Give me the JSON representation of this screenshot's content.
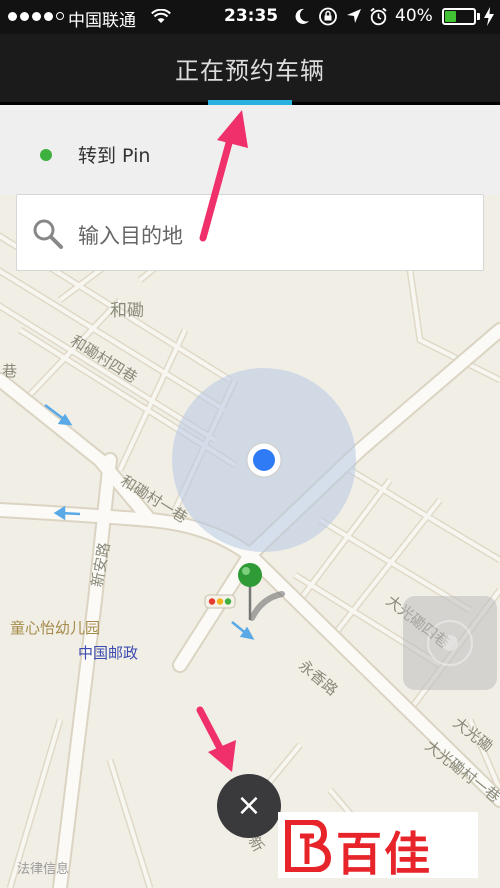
{
  "status_bar": {
    "carrier": "中国联通",
    "time": "23:35",
    "battery_percent": "40%",
    "battery_level": 0.4,
    "signal_bars": 4,
    "icons": [
      "wifi-icon",
      "moon-icon",
      "rotation-lock-icon",
      "location-icon",
      "alarm-icon",
      "charging-icon"
    ]
  },
  "nav": {
    "title": "正在预约车辆"
  },
  "pickup": {
    "label": "转到 Pin"
  },
  "search": {
    "placeholder": "输入目的地"
  },
  "map": {
    "labels": {
      "hekan": "和磡",
      "hekan_village_4": "和磡村四巷",
      "hekan_village_1": "和磡村一巷",
      "lane_left": "巷",
      "xin_an_road": "新安路",
      "kindergarten": "童心怡幼儿园",
      "post_office": "中国邮政",
      "yongxiang_road": "永香路",
      "daguang_4": "大光磡四巷",
      "daguang_1": "大光磡村一巷",
      "daguang_short": "大光磡",
      "road_bottom": "新"
    }
  },
  "footer": {
    "legal": "法律信息",
    "close_symbol": "×",
    "logo_text": "百佳"
  },
  "colors": {
    "accent": "#27b1e0",
    "pin_green": "#3db03d",
    "location_blue": "#2f7bf5",
    "logo_red": "#e8242b",
    "annotation_pink": "#f0306a"
  }
}
